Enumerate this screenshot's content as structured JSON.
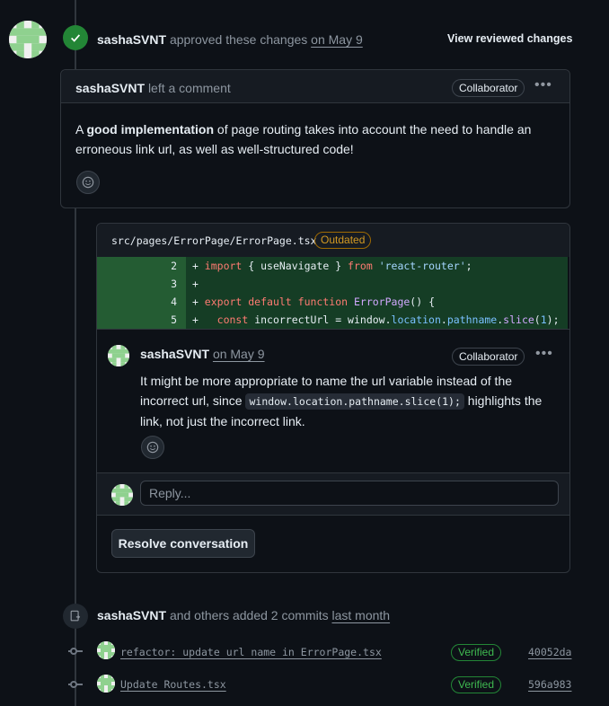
{
  "review": {
    "user": "sashaSVNT",
    "action": "approved these changes",
    "date": "on May 9",
    "view_changes": "View reviewed changes"
  },
  "comment": {
    "user": "sashaSVNT",
    "action": "left a comment",
    "role": "Collaborator",
    "body_pre": "A ",
    "body_bold": "good implementation",
    "body_line1_rest": " of page routing takes into account the need to handle an",
    "body_line2": "erroneous link url, as well as well-structured code!"
  },
  "thread": {
    "file_path": "src/pages/ErrorPage/ErrorPage.tsx",
    "outdated": "Outdated",
    "lines": [
      {
        "num": "2",
        "prefix": "+ ",
        "kw1": "import",
        "t1": " { useNavigate } ",
        "kw2": "from",
        "t2": " ",
        "str": "'react-router'",
        "t3": ";"
      },
      {
        "num": "3",
        "prefix": "+"
      },
      {
        "num": "4",
        "prefix": "+ ",
        "kw1": "export default function",
        "t1": " ",
        "fn": "ErrorPage",
        "t2": "() {"
      },
      {
        "num": "5",
        "prefix": "+   ",
        "kw1": "const",
        "t1": " incorrectUrl = window.",
        "p1": "location",
        "t2": ".",
        "p2": "pathname",
        "t3": ".",
        "fn": "slice",
        "t4": "(",
        "n": "1",
        "t5": ");"
      }
    ],
    "reply_comment": {
      "user": "sashaSVNT",
      "date": "on May 9",
      "role": "Collaborator",
      "line1": "It might be more appropriate to name the url variable instead of the",
      "line2_pre": "incorrect url, since ",
      "code": "window.location.pathname.slice(1);",
      "line2_post": " highlights the",
      "line3": "link, not just the incorrect link."
    },
    "reply_placeholder": "Reply...",
    "resolve_label": "Resolve conversation"
  },
  "commits_event": {
    "user": "sashaSVNT",
    "action": "and others added 2 commits",
    "date": "last month",
    "commits": [
      {
        "message": "refactor: update url name in ErrorPage.tsx",
        "verified": "Verified",
        "sha": "40052da"
      },
      {
        "message": "Update Routes.tsx",
        "verified": "Verified",
        "sha": "596a983"
      }
    ]
  },
  "colors": {
    "accent_green": "#238636",
    "bg": "#0d1117",
    "border": "#30363d"
  }
}
